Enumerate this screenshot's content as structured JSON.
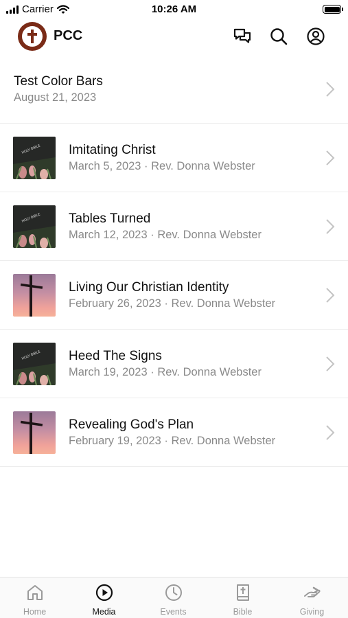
{
  "status_bar": {
    "carrier": "Carrier",
    "time": "10:26 AM"
  },
  "header": {
    "app_name": "PCC",
    "icons": [
      "chat-icon",
      "search-icon",
      "profile-icon"
    ]
  },
  "media_list": [
    {
      "title": "Test Color Bars",
      "meta": "August 21, 2023",
      "thumbnail": "none"
    },
    {
      "title": "Imitating Christ",
      "meta": "March 5, 2023 · Rev. Donna Webster",
      "thumbnail": "bible"
    },
    {
      "title": "Tables Turned",
      "meta": "March 12, 2023 · Rev. Donna Webster",
      "thumbnail": "bible"
    },
    {
      "title": "Living Our Christian Identity",
      "meta": "February 26, 2023 · Rev. Donna Webster",
      "thumbnail": "cross"
    },
    {
      "title": "Heed The Signs",
      "meta": "March 19, 2023 · Rev. Donna Webster",
      "thumbnail": "bible"
    },
    {
      "title": "Revealing God's Plan",
      "meta": "February 19, 2023 · Rev. Donna Webster",
      "thumbnail": "cross"
    }
  ],
  "tabs": [
    {
      "label": "Home",
      "icon": "home-icon",
      "active": false
    },
    {
      "label": "Media",
      "icon": "play-icon",
      "active": true
    },
    {
      "label": "Events",
      "icon": "clock-icon",
      "active": false
    },
    {
      "label": "Bible",
      "icon": "bible-icon",
      "active": false
    },
    {
      "label": "Giving",
      "icon": "giving-hand-icon",
      "active": false
    }
  ],
  "colors": {
    "brand": "#7a2b17",
    "text_primary": "#111111",
    "text_secondary": "#8a8a8a",
    "tab_inactive": "#9a9a9a"
  }
}
